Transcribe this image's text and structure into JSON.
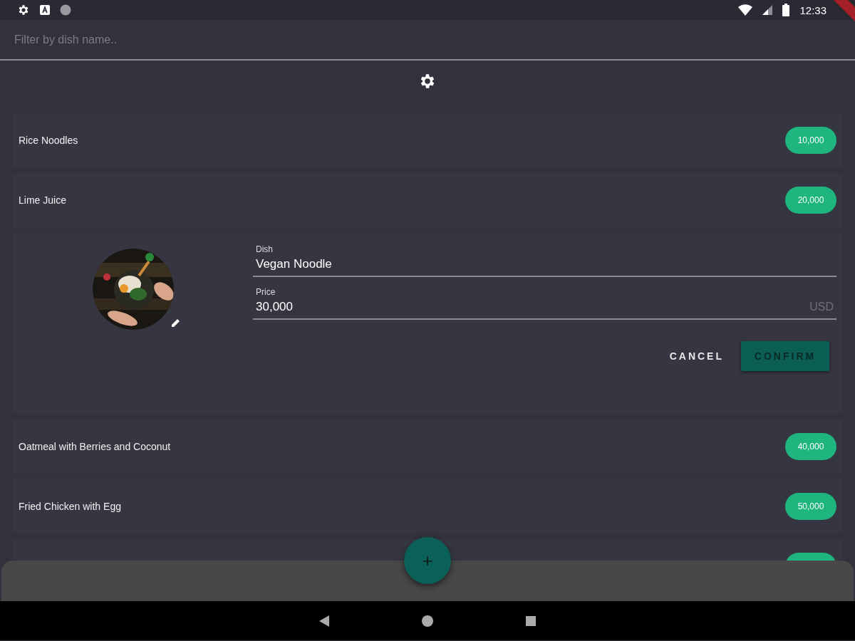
{
  "status_bar": {
    "time": "12:33"
  },
  "search": {
    "placeholder": "Filter by dish name.."
  },
  "dishes": [
    {
      "kind": "row",
      "name": "Rice Noodles",
      "price": "10,000"
    },
    {
      "kind": "row",
      "name": "Lime Juice",
      "price": "20,000"
    },
    {
      "kind": "editor",
      "dish_label": "Dish",
      "dish_value": "Vegan Noodle",
      "price_label": "Price",
      "price_value": "30,000",
      "currency": "USD",
      "cancel": "CANCEL",
      "confirm": "CONFIRM"
    },
    {
      "kind": "row",
      "name": "Oatmeal with Berries and Coconut",
      "price": "40,000"
    },
    {
      "kind": "row",
      "name": "Fried Chicken with Egg",
      "price": "50,000"
    },
    {
      "kind": "partial"
    }
  ],
  "fab": {
    "label": "+"
  }
}
